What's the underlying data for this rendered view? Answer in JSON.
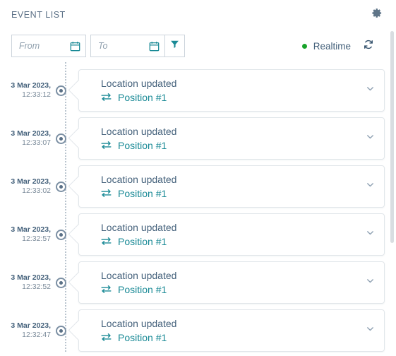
{
  "header": {
    "title": "EVENT LIST",
    "settings_icon": "gear-icon"
  },
  "toolbar": {
    "from_placeholder": "From",
    "from_value": "",
    "to_placeholder": "To",
    "to_value": "",
    "calendar_icon": "calendar-icon",
    "filter_icon": "filter-funnel-icon",
    "realtime_label": "Realtime",
    "realtime_dot_color": "#18a32a",
    "refresh_icon": "refresh-icon"
  },
  "colors": {
    "accent_teal": "#1a8a96",
    "text_slate": "#44617b",
    "border": "#e1e6ea",
    "status_green": "#18a32a"
  },
  "events": [
    {
      "date": "3 Mar 2023,",
      "time": "12:33:12",
      "title": "Location updated",
      "link": "Position #1",
      "link_icon": "transfer-icon",
      "expand_icon": "chevron-down-icon"
    },
    {
      "date": "3 Mar 2023,",
      "time": "12:33:07",
      "title": "Location updated",
      "link": "Position #1",
      "link_icon": "transfer-icon",
      "expand_icon": "chevron-down-icon"
    },
    {
      "date": "3 Mar 2023,",
      "time": "12:33:02",
      "title": "Location updated",
      "link": "Position #1",
      "link_icon": "transfer-icon",
      "expand_icon": "chevron-down-icon"
    },
    {
      "date": "3 Mar 2023,",
      "time": "12:32:57",
      "title": "Location updated",
      "link": "Position #1",
      "link_icon": "transfer-icon",
      "expand_icon": "chevron-down-icon"
    },
    {
      "date": "3 Mar 2023,",
      "time": "12:32:52",
      "title": "Location updated",
      "link": "Position #1",
      "link_icon": "transfer-icon",
      "expand_icon": "chevron-down-icon"
    },
    {
      "date": "3 Mar 2023,",
      "time": "12:32:47",
      "title": "Location updated",
      "link": "Position #1",
      "link_icon": "transfer-icon",
      "expand_icon": "chevron-down-icon"
    }
  ]
}
